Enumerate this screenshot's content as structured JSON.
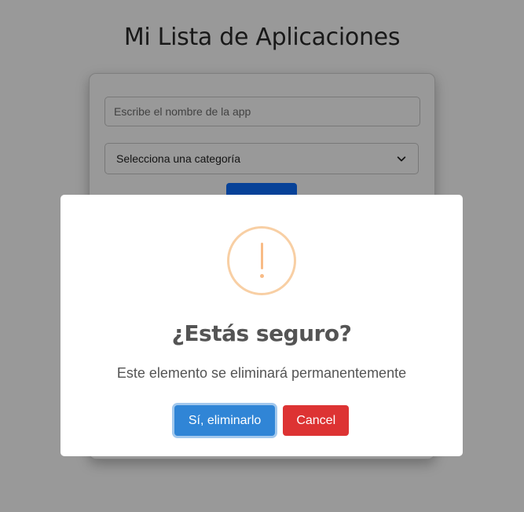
{
  "page": {
    "title": "Mi Lista de Aplicaciones",
    "search": {
      "placeholder": "Escribe el nombre de la app",
      "value": ""
    },
    "category_select": {
      "selected": "Selecciona una categoría",
      "icon": "chevron-down-icon"
    },
    "add_button": {
      "label": ""
    }
  },
  "dialog": {
    "icon": "warning-icon",
    "title": "¿Estás seguro?",
    "text": "Este elemento se eliminará permanentemente",
    "confirm_label": "Sí, eliminarlo",
    "cancel_label": "Cancel"
  },
  "colors": {
    "confirm": "#3085d6",
    "cancel": "#dd3333",
    "warning": "#f8bb86",
    "primary": "#0d6efd"
  }
}
